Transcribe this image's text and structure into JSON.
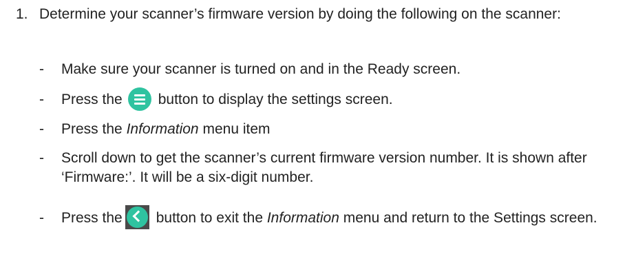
{
  "step": {
    "number": "1.",
    "text": "Determine your scanner’s firmware version by doing the following on the scanner:"
  },
  "substeps": {
    "dash": "-",
    "s1": "Make sure your scanner is turned on and in the Ready screen.",
    "s2_before": "Press the",
    "s2_after": "button to display the settings screen.",
    "s3_before": "Press the",
    "s3_italic": "Information",
    "s3_after": "menu item",
    "s4": "Scroll down to get the scanner’s current firmware version number. It is shown after ‘Firmware:’. It will be a six-digit number.",
    "s5_before": "Press the",
    "s5_mid": "button to exit the",
    "s5_italic": "Information",
    "s5_after": "menu and return to the Settings screen."
  },
  "icons": {
    "settings_menu_icon": "menu-lines-icon",
    "back_icon": "chevron-left-icon",
    "accent_color": "#2fc3a0"
  }
}
